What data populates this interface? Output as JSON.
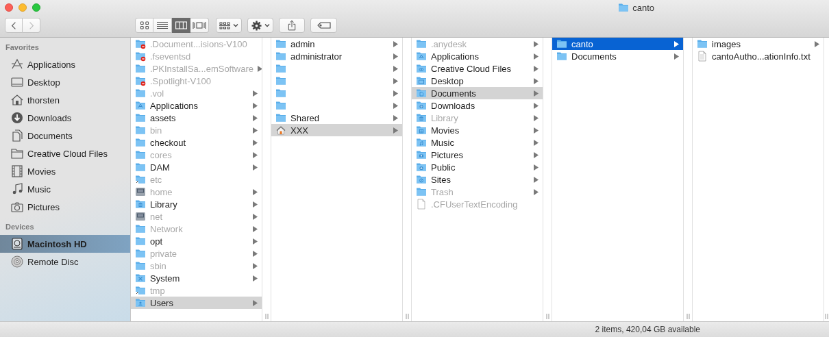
{
  "window": {
    "title": "canto"
  },
  "toolbar": {
    "back": {
      "disabled": false
    },
    "forward": {
      "disabled": true
    },
    "view_modes": [
      {
        "kind": "icons",
        "selected": false
      },
      {
        "kind": "list",
        "selected": false
      },
      {
        "kind": "columns",
        "selected": true
      },
      {
        "kind": "coverflow",
        "selected": false
      }
    ]
  },
  "sidebar": {
    "sections": [
      {
        "title": "Favorites",
        "items": [
          {
            "label": "Applications",
            "kind": "apps",
            "selected": false
          },
          {
            "label": "Desktop",
            "kind": "desktop",
            "selected": false
          },
          {
            "label": "thorsten",
            "kind": "home",
            "selected": false
          },
          {
            "label": "Downloads",
            "kind": "downloads",
            "selected": false
          },
          {
            "label": "Documents",
            "kind": "documents",
            "selected": false
          },
          {
            "label": "Creative Cloud Files",
            "kind": "folder",
            "selected": false
          },
          {
            "label": "Movies",
            "kind": "movies",
            "selected": false
          },
          {
            "label": "Music",
            "kind": "music",
            "selected": false
          },
          {
            "label": "Pictures",
            "kind": "pictures",
            "selected": false
          }
        ]
      },
      {
        "title": "Devices",
        "items": [
          {
            "label": "Macintosh HD",
            "kind": "disk",
            "selected": true
          },
          {
            "label": "Remote Disc",
            "kind": "disc",
            "selected": false
          }
        ]
      }
    ]
  },
  "columns": [
    {
      "active": false,
      "items": [
        {
          "name": ".Document...isions-V100",
          "kind": "noentry",
          "dimmed": true,
          "has_children": false,
          "selected": false
        },
        {
          "name": ".fseventsd",
          "kind": "noentry",
          "dimmed": true,
          "has_children": false,
          "selected": false
        },
        {
          "name": ".PKInstallSa...emSoftware",
          "kind": "folder",
          "dimmed": true,
          "has_children": true,
          "selected": false
        },
        {
          "name": ".Spotlight-V100",
          "kind": "noentry",
          "dimmed": true,
          "has_children": false,
          "selected": false
        },
        {
          "name": ".vol",
          "kind": "folder",
          "dimmed": true,
          "has_children": true,
          "selected": false
        },
        {
          "name": "Applications",
          "kind": "apps",
          "dimmed": false,
          "has_children": true,
          "selected": false
        },
        {
          "name": "assets",
          "kind": "folder",
          "dimmed": false,
          "has_children": true,
          "selected": false
        },
        {
          "name": "bin",
          "kind": "folder",
          "dimmed": true,
          "has_children": true,
          "selected": false
        },
        {
          "name": "checkout",
          "kind": "folder",
          "dimmed": false,
          "has_children": true,
          "selected": false
        },
        {
          "name": "cores",
          "kind": "folder",
          "dimmed": true,
          "has_children": true,
          "selected": false
        },
        {
          "name": "DAM",
          "kind": "folder",
          "dimmed": false,
          "has_children": true,
          "selected": false
        },
        {
          "name": "etc",
          "kind": "alias",
          "dimmed": true,
          "has_children": false,
          "selected": false
        },
        {
          "name": "home",
          "kind": "drive",
          "dimmed": true,
          "has_children": true,
          "selected": false
        },
        {
          "name": "Library",
          "kind": "library",
          "dimmed": false,
          "has_children": true,
          "selected": false
        },
        {
          "name": "net",
          "kind": "drive",
          "dimmed": true,
          "has_children": true,
          "selected": false
        },
        {
          "name": "Network",
          "kind": "folder",
          "dimmed": true,
          "has_children": true,
          "selected": false
        },
        {
          "name": "opt",
          "kind": "folder",
          "dimmed": false,
          "has_children": true,
          "selected": false
        },
        {
          "name": "private",
          "kind": "folder",
          "dimmed": true,
          "has_children": true,
          "selected": false
        },
        {
          "name": "sbin",
          "kind": "folder",
          "dimmed": true,
          "has_children": true,
          "selected": false
        },
        {
          "name": "System",
          "kind": "system",
          "dimmed": false,
          "has_children": true,
          "selected": false
        },
        {
          "name": "tmp",
          "kind": "alias",
          "dimmed": true,
          "has_children": false,
          "selected": false
        },
        {
          "name": "Users",
          "kind": "users",
          "dimmed": false,
          "has_children": true,
          "selected": true
        }
      ]
    },
    {
      "active": false,
      "items": [
        {
          "name": "admin",
          "kind": "folder",
          "dimmed": false,
          "has_children": true,
          "selected": false
        },
        {
          "name": "administrator",
          "kind": "folder",
          "dimmed": false,
          "has_children": true,
          "selected": false
        },
        {
          "kind": "folder",
          "dimmed": false,
          "has_children": true,
          "selected": false
        },
        {
          "kind": "folder",
          "dimmed": false,
          "has_children": true,
          "selected": false
        },
        {
          "kind": "folder",
          "dimmed": false,
          "has_children": true,
          "selected": false
        },
        {
          "kind": "folder",
          "dimmed": false,
          "has_children": true,
          "selected": false
        },
        {
          "name": "Shared",
          "kind": "folder",
          "dimmed": false,
          "has_children": true,
          "selected": false
        },
        {
          "name": "XXX",
          "kind": "home",
          "dimmed": false,
          "has_children": true,
          "selected": true
        }
      ]
    },
    {
      "active": false,
      "items": [
        {
          "name": ".anydesk",
          "kind": "folder",
          "dimmed": true,
          "has_children": true,
          "selected": false
        },
        {
          "name": "Applications",
          "kind": "apps",
          "dimmed": false,
          "has_children": true,
          "selected": false
        },
        {
          "name": "Creative Cloud Files",
          "kind": "cloud",
          "dimmed": false,
          "has_children": true,
          "selected": false
        },
        {
          "name": "Desktop",
          "kind": "desktop",
          "dimmed": false,
          "has_children": true,
          "selected": false
        },
        {
          "name": "Documents",
          "kind": "documents",
          "dimmed": false,
          "has_children": true,
          "selected": true
        },
        {
          "name": "Downloads",
          "kind": "downloads",
          "dimmed": false,
          "has_children": true,
          "selected": false
        },
        {
          "name": "Library",
          "kind": "library",
          "dimmed": true,
          "has_children": true,
          "selected": false
        },
        {
          "name": "Movies",
          "kind": "movies",
          "dimmed": false,
          "has_children": true,
          "selected": false
        },
        {
          "name": "Music",
          "kind": "music",
          "dimmed": false,
          "has_children": true,
          "selected": false
        },
        {
          "name": "Pictures",
          "kind": "pictures",
          "dimmed": false,
          "has_children": true,
          "selected": false
        },
        {
          "name": "Public",
          "kind": "public",
          "dimmed": false,
          "has_children": true,
          "selected": false
        },
        {
          "name": "Sites",
          "kind": "sites",
          "dimmed": false,
          "has_children": true,
          "selected": false
        },
        {
          "name": "Trash",
          "kind": "folder",
          "dimmed": true,
          "has_children": true,
          "selected": false
        },
        {
          "name": ".CFUserTextEncoding",
          "kind": "file",
          "dimmed": true,
          "has_children": false,
          "selected": false
        }
      ]
    },
    {
      "active": true,
      "items": [
        {
          "name": "canto",
          "kind": "folder",
          "dimmed": false,
          "has_children": true,
          "selected": true
        },
        {
          "name": "Documents",
          "kind": "folder",
          "dimmed": false,
          "has_children": true,
          "selected": false
        }
      ]
    },
    {
      "active": false,
      "items": [
        {
          "name": "images",
          "kind": "folder",
          "dimmed": false,
          "has_children": true,
          "selected": false
        },
        {
          "name": "cantoAutho...ationInfo.txt",
          "kind": "textfile",
          "dimmed": false,
          "has_children": false,
          "selected": false
        }
      ]
    }
  ],
  "status_bar": "2 items, 420,04 GB available"
}
